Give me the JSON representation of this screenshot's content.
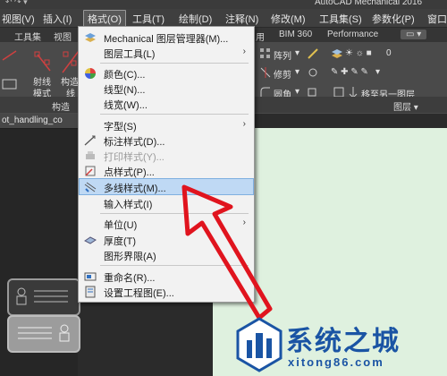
{
  "window": {
    "title": "AutoCAD Mechanical 2016",
    "quick_access": "↶ ↷ ▾"
  },
  "menubar": {
    "items": [
      {
        "label": "视图(V)"
      },
      {
        "label": "插入(I)"
      },
      {
        "label": "格式(O)",
        "active": true
      },
      {
        "label": "工具(T)"
      },
      {
        "label": "绘制(D)"
      },
      {
        "label": "注释(N)"
      },
      {
        "label": "修改(M)"
      },
      {
        "label": "工具集(S)"
      },
      {
        "label": "参数化(P)"
      },
      {
        "label": "窗口("
      }
    ]
  },
  "ribbon_tabs": {
    "items": [
      "工具集",
      "视图",
      "用",
      "BIM 360",
      "Performance"
    ]
  },
  "ribbon": {
    "left_buttons": [
      {
        "line1": "射线",
        "line2": "模式"
      },
      {
        "line1": "构造",
        "line2": "线"
      }
    ],
    "right_tools": {
      "array": "阵列",
      "trim": "修剪",
      "fillet": "圆角",
      "layer_value": "0",
      "move_to_layer": "移至另一图层"
    }
  },
  "panel_titles": {
    "construct": "构造",
    "layers": "图层 ▾"
  },
  "file_tab": {
    "label": "ot_handling_co"
  },
  "format_menu": {
    "items": [
      {
        "label": "Mechanical 图层管理器(M)...",
        "icon": "layer-manager-icon"
      },
      {
        "label": "图层工具(L)",
        "submenu": true
      },
      {
        "label": "颜色(C)...",
        "icon": "color-wheel-icon",
        "separator_before": true
      },
      {
        "label": "线型(N)..."
      },
      {
        "label": "线宽(W)..."
      },
      {
        "label": "字型(S)",
        "submenu": true,
        "separator_before": true
      },
      {
        "label": "标注样式(D)...",
        "icon": "dimension-style-icon"
      },
      {
        "label": "打印样式(Y)...",
        "icon": "print-style-icon",
        "disabled": true
      },
      {
        "label": "点样式(P)...",
        "icon": "point-style-icon"
      },
      {
        "label": "多线样式(M)...",
        "icon": "multiline-style-icon",
        "highlighted": true
      },
      {
        "label": "输入样式(I)"
      },
      {
        "label": "单位(U)",
        "submenu": true,
        "separator_before": true
      },
      {
        "label": "厚度(T)",
        "icon": "thickness-icon"
      },
      {
        "label": "图形界限(A)"
      },
      {
        "label": "重命名(R)...",
        "icon": "rename-icon",
        "separator_before": true
      },
      {
        "label": "设置工程图(E)...",
        "icon": "drawing-setup-icon"
      }
    ]
  },
  "watermark": {
    "brand": "系统之城",
    "url": "xitong86.com"
  },
  "colors": {
    "menu_bg": "#f2f2f2",
    "highlight": "#bfd9f4",
    "annotation_arrow": "#e0141e",
    "drawing_bg": "#dff1df",
    "watermark_blue": "#1a54a4"
  }
}
